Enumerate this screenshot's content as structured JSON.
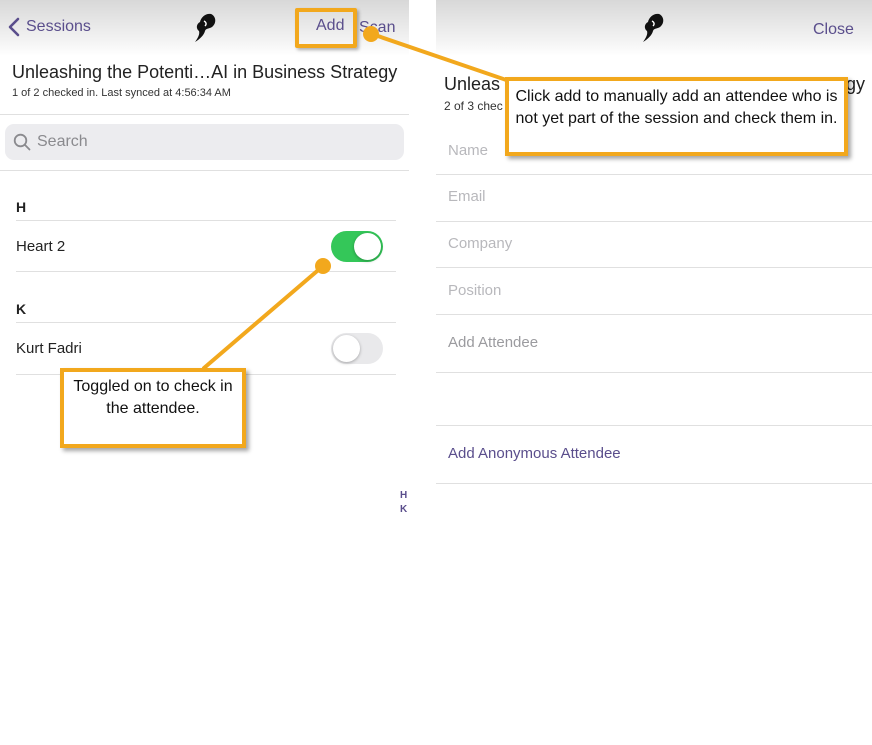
{
  "left_screen": {
    "nav": {
      "back_label": "Sessions",
      "add_label": "Add",
      "scan_label": "Scan"
    },
    "session": {
      "title": "Unleashing the Potenti…AI in Business Strategy",
      "subtitle": "1 of 2 checked in. Last synced at 4:56:34 AM"
    },
    "search": {
      "placeholder": "Search"
    },
    "sections": [
      {
        "letter": "H",
        "attendees": [
          {
            "name": "Heart 2",
            "checked_in": true
          }
        ]
      },
      {
        "letter": "K",
        "attendees": [
          {
            "name": "Kurt Fadri",
            "checked_in": false
          }
        ]
      }
    ],
    "index_letters": [
      "H",
      "K"
    ]
  },
  "right_screen": {
    "nav": {
      "close_label": "Close"
    },
    "title_start": "Unleas",
    "title_end": "gy",
    "subtitle": "2 of 3 chec",
    "fields": {
      "name_placeholder": "Name",
      "email_placeholder": "Email",
      "company_placeholder": "Company",
      "position_placeholder": "Position"
    },
    "add_attendee_label": "Add Attendee",
    "add_anonymous_label": "Add Anonymous Attendee"
  },
  "annotations": {
    "add_callout": "Click add to manually add an attendee who is not yet part of the session and check them in.",
    "toggle_callout": "Toggled on to check in the attendee."
  },
  "colors": {
    "accent_purple": "#5a4e8c",
    "toggle_on": "#34c759",
    "toggle_off": "#e9e9eb",
    "annotation_orange": "#f2a81d"
  },
  "icons": {
    "back": "chevron-left-icon",
    "logo": "feather-logo-icon",
    "search": "search-icon"
  }
}
